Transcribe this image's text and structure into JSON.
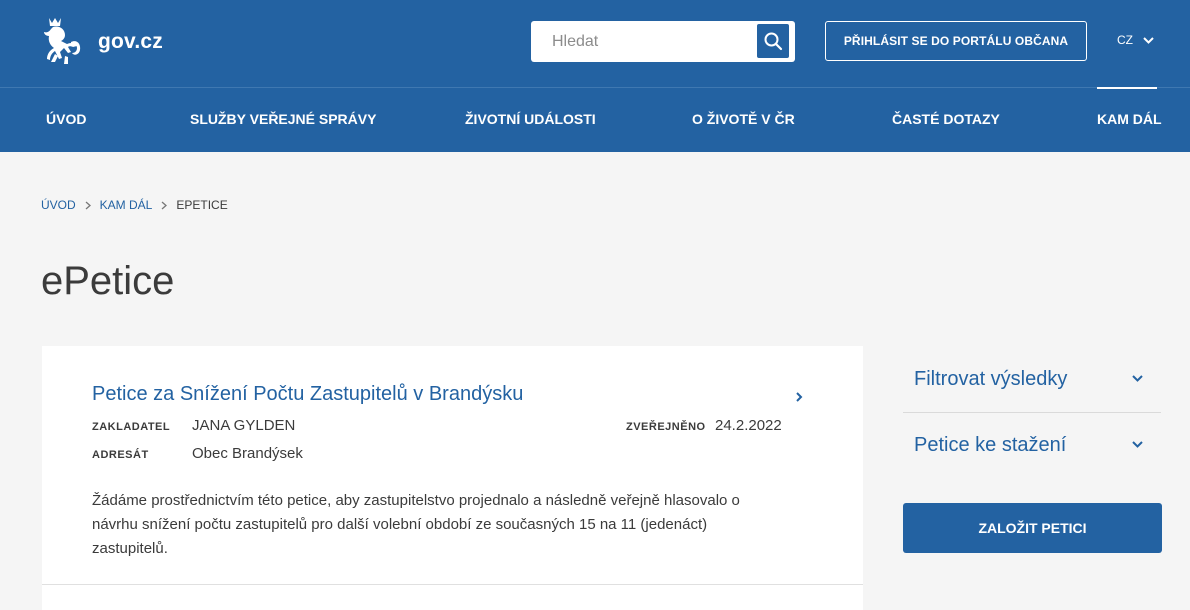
{
  "header": {
    "logo_text": "gov.cz",
    "search_placeholder": "Hledat",
    "login_label": "PŘIHLÁSIT SE DO PORTÁLU OBČANA",
    "lang_label": "CZ",
    "brand_color": "#2362a2"
  },
  "nav": {
    "items": [
      {
        "label": "ÚVOD"
      },
      {
        "label": "SLUŽBY VEŘEJNÉ SPRÁVY"
      },
      {
        "label": "ŽIVOTNÍ UDÁLOSTI"
      },
      {
        "label": "O ŽIVOTĚ V ČR"
      },
      {
        "label": "ČASTÉ DOTAZY"
      },
      {
        "label": "KAM DÁL",
        "active": true
      }
    ]
  },
  "breadcrumb": {
    "items": [
      "ÚVOD",
      "KAM DÁL"
    ],
    "current": "EPETICE"
  },
  "page_title": "ePetice",
  "petition": {
    "title": "Petice za Snížení Počtu Zastupitelů v Brandýsku",
    "founder_label": "ZAKLADATEL",
    "founder": "JANA GYLDEN",
    "published_label": "ZVEŘEJNĚNO",
    "published": "24.2.2022",
    "addressee_label": "ADRESÁT",
    "addressee": "Obec Brandýsek",
    "description": "Žádáme prostřednictvím této petice, aby zastupitelstvo projednalo a následně veřejně hlasovalo o návrhu snížení počtu zastupitelů pro další volební období ze současných 15 na 11 (jedenáct) zastupitelů."
  },
  "sidebar": {
    "filter_label": "Filtrovat výsledky",
    "download_label": "Petice ke stažení",
    "create_label": "ZALOŽIT PETICI"
  },
  "icons": {
    "logo": "lion-coat-of-arms-icon",
    "search": "search-icon",
    "chevron": "chevron-down-icon",
    "arrow": "chevron-right-icon"
  }
}
